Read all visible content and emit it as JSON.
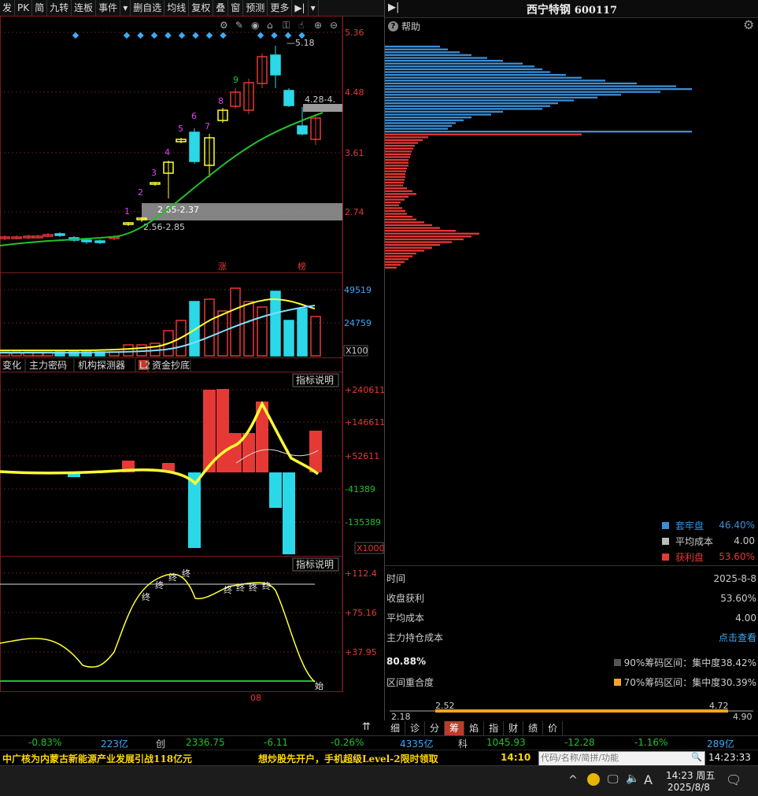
{
  "toolbar": {
    "items": [
      "发",
      "PK",
      "简",
      "九转",
      "连板",
      "事件",
      "▾",
      "删自选",
      "均线",
      "复权",
      "叠",
      "窗",
      "预测",
      "更多",
      "▶|",
      "▾"
    ]
  },
  "price_axis": [
    "5.36",
    "4.48",
    "3.61",
    "2.74"
  ],
  "candle_annotations": {
    "high_label": "5.18",
    "range_label_top": "4.28-4.",
    "band_label": "2.85-2.37",
    "band_label2": "2.56-2.85",
    "seq": [
      "1",
      "2",
      "3",
      "4",
      "5",
      "6",
      "7",
      "8",
      "9"
    ],
    "tag_zhang": "涨",
    "tag_bang": "榜"
  },
  "volume": {
    "axis": [
      "49519",
      "24759"
    ],
    "unit": "X100"
  },
  "indicator_tabs": [
    "变化",
    "主力密码",
    "机构探测器",
    "L2",
    "资金抄底"
  ],
  "fund": {
    "desc_label": "指标说明",
    "axis": [
      "+240611",
      "+146611",
      "+52611",
      "-41389",
      "-135389"
    ],
    "unit": "X1000"
  },
  "osc": {
    "desc_label": "指标说明",
    "axis": [
      "+112.4",
      "+75.16",
      "+37.95"
    ],
    "zhong": "终",
    "shi": "始",
    "month": "08"
  },
  "right": {
    "stock_name": "西宁特钢",
    "stock_code": "600117",
    "help": "帮助",
    "legend": [
      {
        "label": "套牢盘",
        "value": "46.40%",
        "color": "#3a8fd6"
      },
      {
        "label": "平均成本",
        "value": "4.00",
        "color": "#bbbbbb"
      },
      {
        "label": "获利盘",
        "value": "53.60%",
        "color": "#e53935"
      }
    ],
    "rows": [
      {
        "label": "时间",
        "value": "2025-8-8"
      },
      {
        "label": "收盘获利",
        "value": "53.60%"
      },
      {
        "label": "平均成本",
        "value": "4.00"
      },
      {
        "label": "主力持仓成本",
        "value": "点击查看"
      }
    ],
    "overlap_pct": "80.88%",
    "overlap_label": "区间重合度",
    "band90": "90%筹码区间：集中度38.42%",
    "band70": "70%筹码区间：集中度30.39%",
    "range": {
      "l1": "2.52",
      "r1": "4.72",
      "l2": "2.18",
      "r2": "4.90"
    }
  },
  "bottom_tabs": [
    "细",
    "诊",
    "分",
    "筹",
    "焰",
    "指",
    "财",
    "绩",
    "价"
  ],
  "index_bar": {
    "a1": "-0.83%",
    "a2": "223亿",
    "b0": "创",
    "b1": "2336.75",
    "b2": "-6.11",
    "b3": "-0.26%",
    "b4": "4335亿",
    "c0": "科",
    "c1": "1045.93",
    "c2": "-12.28",
    "c3": "-1.16%",
    "c4": "289亿"
  },
  "news": {
    "n1": "中广核为内蒙古新能源产业发展引战118亿元",
    "n2": "想炒股先开户，手机超级Level-2限时领取",
    "time1": "14:10",
    "search_placeholder": "代码/名称/简拼/功能",
    "clock": "14:23:33"
  },
  "taskbar": {
    "time": "14:23 周五",
    "date": "2025/8/8",
    "lang": "A"
  },
  "colors": {
    "up": "#e53935",
    "down": "#2ad8e8",
    "ma": "#22c02a",
    "yellow": "#ffff33"
  }
}
